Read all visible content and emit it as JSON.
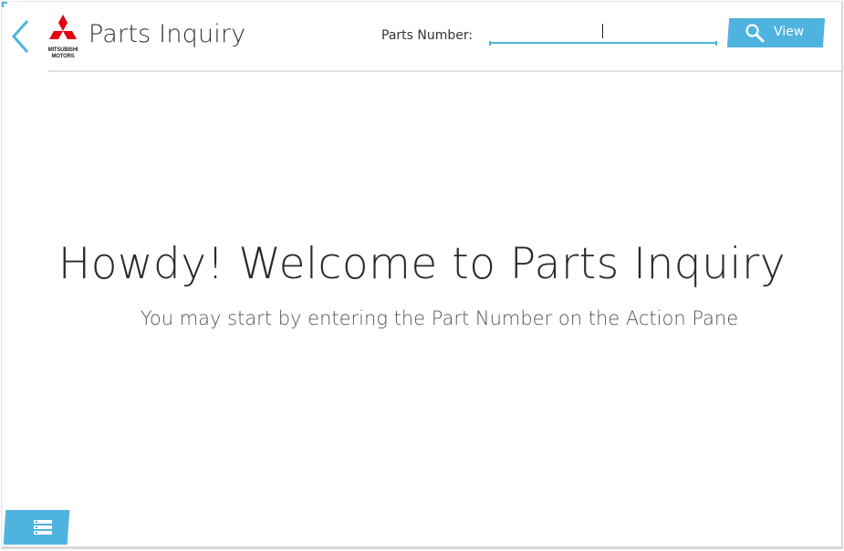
{
  "header": {
    "title": "Parts Inquiry",
    "logo_text_line1": "MITSUBISHI",
    "logo_text_line2": "MOTORS",
    "back_icon": "chevron-left-icon"
  },
  "search": {
    "label": "Parts Number:",
    "value": "",
    "placeholder": "",
    "button_label": "View",
    "button_icon": "search-icon"
  },
  "main": {
    "welcome_title": "Howdy! Welcome to Parts Inquiry",
    "welcome_subtitle": "You may start by entering the Part Number on the Action Pane"
  },
  "action_pane": {
    "icon": "menu-list-icon"
  },
  "colors": {
    "accent": "#4fb3e0",
    "logo_red": "#e60012",
    "text_dark": "#2a2a2a",
    "divider": "#e2e2e2"
  }
}
